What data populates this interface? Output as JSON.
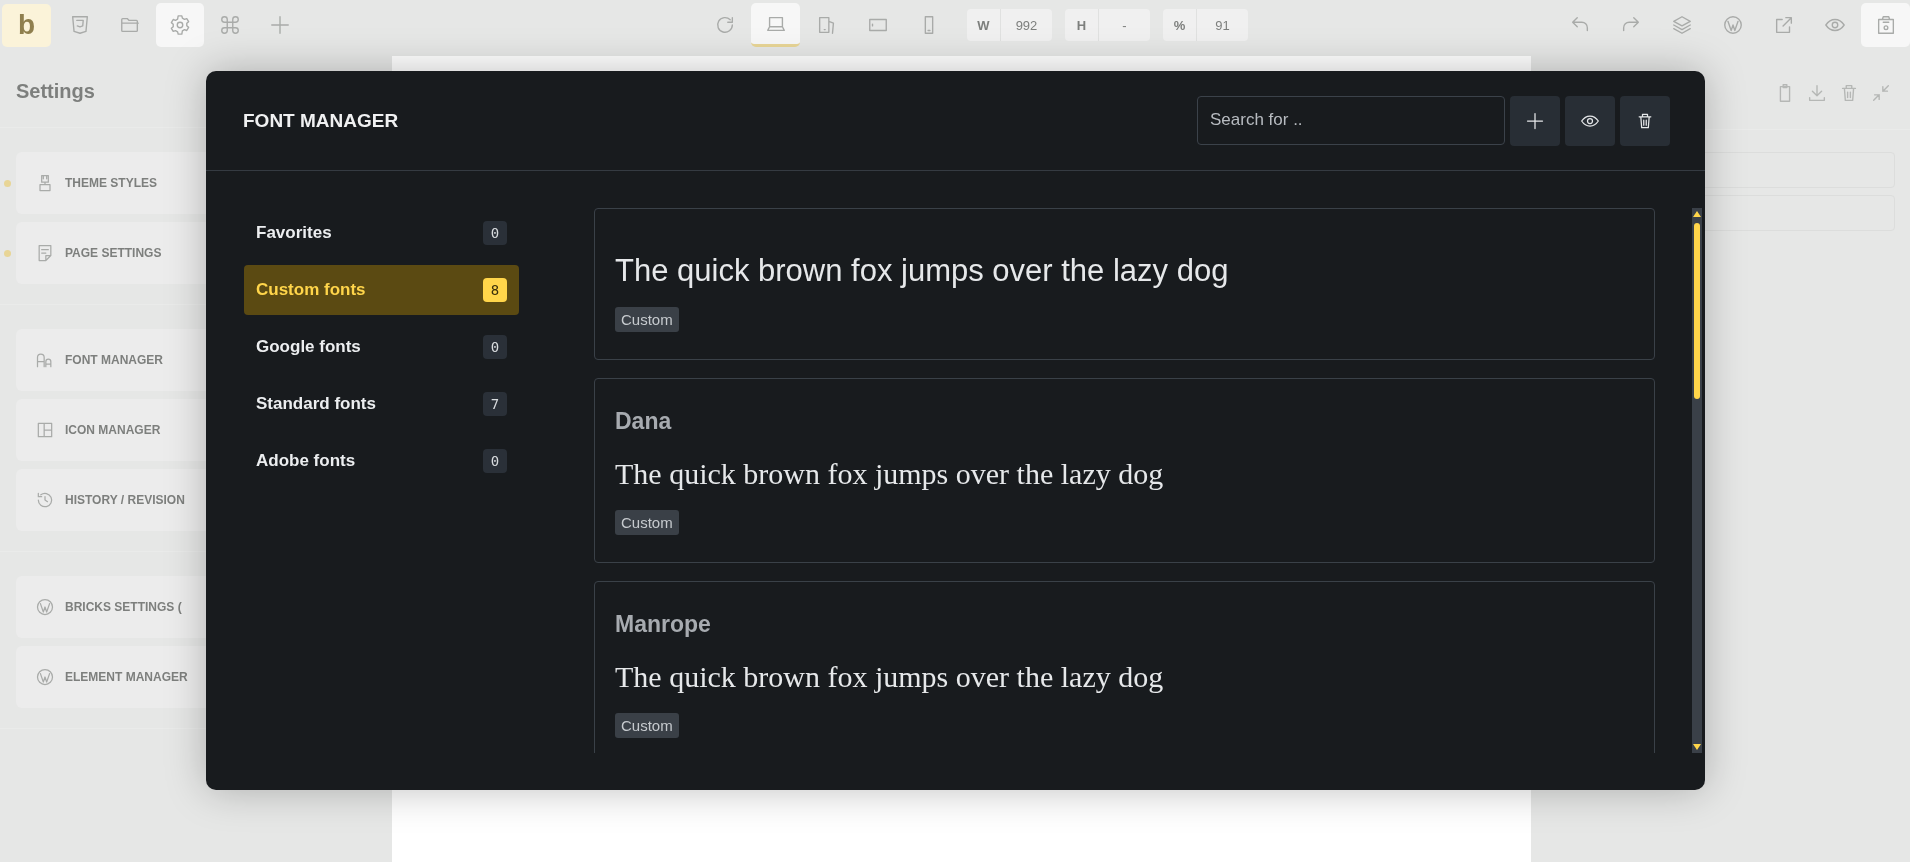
{
  "toolbar": {
    "logo": "b",
    "left_tools": [
      {
        "selected": false
      },
      {
        "selected": false
      },
      {
        "selected": true
      },
      {
        "selected": false
      },
      {
        "selected": false
      }
    ],
    "devices": [
      {
        "selected": false
      },
      {
        "selected": true
      },
      {
        "selected": false
      },
      {
        "selected": false
      },
      {
        "selected": false
      }
    ],
    "fields": [
      {
        "label": "W",
        "value": "992"
      },
      {
        "label": "H",
        "value": "-"
      },
      {
        "label": "%",
        "value": "91"
      }
    ],
    "right_tools": [
      {
        "selected": false
      },
      {
        "selected": false
      },
      {
        "selected": false
      },
      {
        "selected": false
      },
      {
        "selected": false
      },
      {
        "selected": false
      },
      {
        "selected": true
      }
    ]
  },
  "settings": {
    "title": "Settings",
    "groups": [
      {
        "items": [
          {
            "label": "THEME STYLES",
            "modified": true
          },
          {
            "label": "PAGE SETTINGS",
            "modified": true
          }
        ]
      },
      {
        "items": [
          {
            "label": "FONT MANAGER",
            "modified": false
          },
          {
            "label": "ICON MANAGER",
            "modified": false
          },
          {
            "label": "HISTORY / REVISION",
            "modified": false
          }
        ]
      },
      {
        "items": [
          {
            "label": "BRICKS SETTINGS (",
            "modified": false
          },
          {
            "label": "ELEMENT MANAGER",
            "modified": false
          }
        ]
      }
    ]
  },
  "font_manager": {
    "title": "FONT MANAGER",
    "search": {
      "placeholder": "Search for .."
    },
    "categories": [
      {
        "label": "Favorites",
        "count": "0",
        "selected": false
      },
      {
        "label": "Custom fonts",
        "count": "8",
        "selected": true
      },
      {
        "label": "Google fonts",
        "count": "0",
        "selected": false
      },
      {
        "label": "Standard fonts",
        "count": "7",
        "selected": false
      },
      {
        "label": "Adobe fonts",
        "count": "0",
        "selected": false
      }
    ],
    "fonts": [
      {
        "kind": "sans",
        "sample": "The quick brown fox jumps over the lazy dog",
        "tag": "Custom"
      },
      {
        "kind": "serif",
        "name": "Dana",
        "sample": "The quick brown fox jumps over the lazy dog",
        "tag": "Custom"
      },
      {
        "kind": "serif",
        "name": "Manrope",
        "sample": "The quick brown fox jumps over the lazy dog",
        "tag": "Custom"
      }
    ]
  }
}
